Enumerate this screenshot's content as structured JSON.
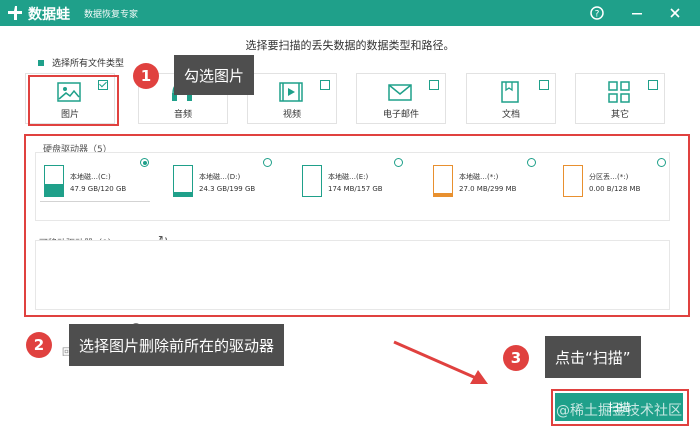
{
  "titlebar": {
    "app_name": "数据蛙",
    "subtitle": "数据恢复专家",
    "help_icon": "help-icon",
    "minimize_icon": "minimize-icon",
    "close_icon": "close-icon",
    "color": "#1fa08a"
  },
  "prompt": "选择要扫描的丢失数据的数据类型和路径。",
  "select_all_label": "选择所有文件类型",
  "file_types": [
    {
      "label": "图片",
      "checked": true,
      "icon": "image-icon"
    },
    {
      "label": "音频",
      "checked": false,
      "icon": "audio-icon"
    },
    {
      "label": "视频",
      "checked": false,
      "icon": "video-icon"
    },
    {
      "label": "电子邮件",
      "checked": false,
      "icon": "email-icon"
    },
    {
      "label": "文档",
      "checked": false,
      "icon": "document-icon"
    },
    {
      "label": "其它",
      "checked": false,
      "icon": "other-icon"
    }
  ],
  "annotations": {
    "step1": {
      "num": "1",
      "text": "勾选图片"
    },
    "step2": {
      "num": "2",
      "text": "选择图片删除前所在的驱动器"
    },
    "step3": {
      "num": "3",
      "text": "点击“扫描”"
    },
    "highlight_color": "#e0413f"
  },
  "hard_drives": {
    "title": "硬盘驱动器（5）",
    "drives": [
      {
        "name": "本地磁…(C:)",
        "size": "47.9 GB/120 GB",
        "selected": true,
        "fill": 0.4,
        "color": "#1fa08a"
      },
      {
        "name": "本地磁…(D:)",
        "size": "24.3 GB/199 GB",
        "selected": false,
        "fill": 0.12,
        "color": "#1fa08a"
      },
      {
        "name": "本地磁…(E:)",
        "size": "174 MB/157 GB",
        "selected": false,
        "fill": 0.0,
        "color": "#1fa08a"
      },
      {
        "name": "本地磁…(*:)",
        "size": "27.0 MB/299 MB",
        "selected": false,
        "fill": 0.1,
        "color": "#e8902f"
      },
      {
        "name": "分区丢…(*:)",
        "size": "0.00 B/128 MB",
        "selected": false,
        "fill": 0.0,
        "color": "#e8902f"
      }
    ]
  },
  "removable": {
    "title": "可移动驱动器（0）",
    "refresh_icon": "refresh-icon"
  },
  "scan_button_label": "扫描",
  "watermark": "@稀土掘金技术社区",
  "faint_text": "回收站"
}
